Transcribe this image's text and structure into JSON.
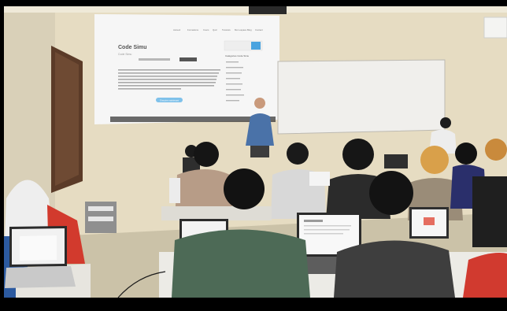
{
  "projection": {
    "site_title": "Code Simu",
    "site_subtitle": "Code Simu",
    "nav_items": [
      "Accueil",
      "Formations",
      "Cours",
      "Quiz",
      "Tutoriels",
      "Mon espace",
      "Blog",
      "Contact"
    ],
    "sidebar_heading": "Catégories Code Simu",
    "cta_label": "S'inscrire maintenant"
  },
  "colors": {
    "wall": "#e8dfc6",
    "screen": "#f7f7f7",
    "whiteboard": "#f2f1ee",
    "accent": "#4aa3df",
    "floor": "#cfc6ad"
  }
}
